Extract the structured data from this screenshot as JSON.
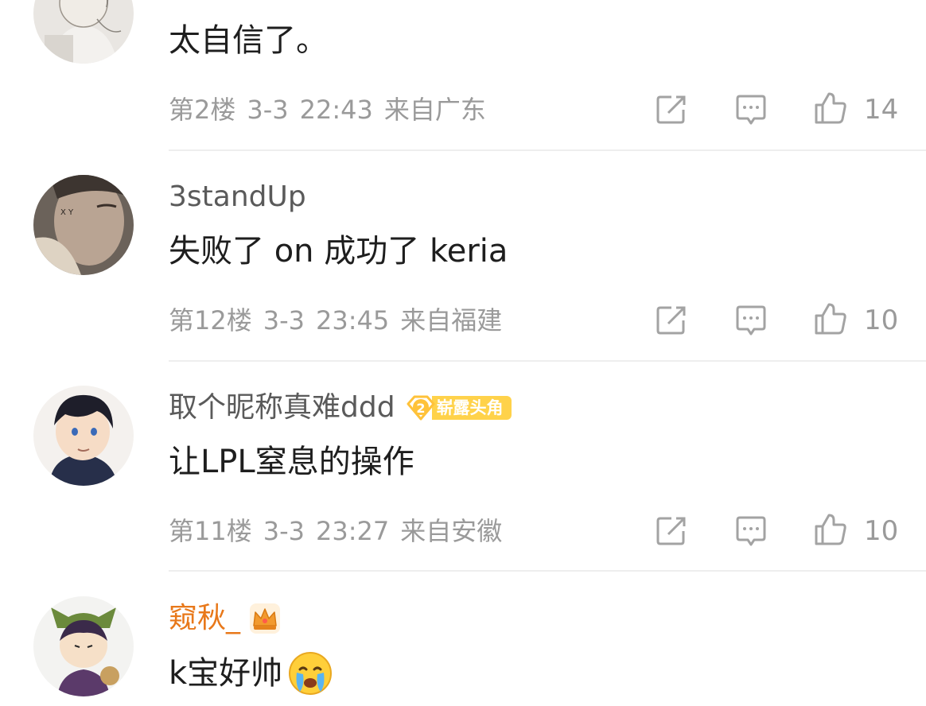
{
  "comments": [
    {
      "username": "",
      "text": "太自信了。",
      "floor": "第2楼",
      "date": "3-3",
      "time": "22:43",
      "location": "来自广东",
      "likes": "14"
    },
    {
      "username": "3standUp",
      "text": "失败了 on  成功了 keria",
      "floor": "第12楼",
      "date": "3-3",
      "time": "23:45",
      "location": "来自福建",
      "likes": "10"
    },
    {
      "username": "取个昵称真难ddd",
      "badge_level": "2",
      "badge_label": "崭露头角",
      "text": "让LPL窒息的操作",
      "floor": "第11楼",
      "date": "3-3",
      "time": "23:27",
      "location": "来自安徽",
      "likes": "10"
    },
    {
      "username": "窥秋_",
      "text": "k宝好帅",
      "emoji": "crying-face-icon"
    }
  ],
  "colors": {
    "vip_name": "#e8781a",
    "badge": "#ffd24a",
    "meta": "#9a9a9a"
  }
}
